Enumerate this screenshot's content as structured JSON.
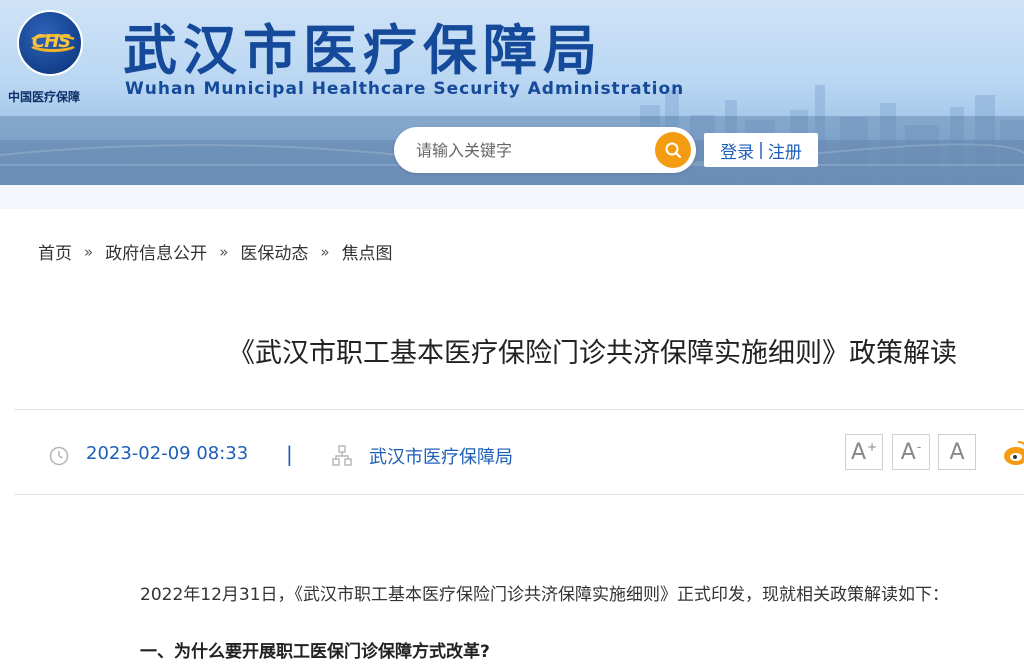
{
  "header": {
    "logo_text": "CHS",
    "logo_caption": "中国医疗保障",
    "site_title": "武汉市医疗保障局",
    "site_subtitle": "Wuhan Municipal Healthcare Security Administration",
    "search_placeholder": "请输入关键字",
    "login_label": "登录",
    "login_separator": "|",
    "register_label": "注册"
  },
  "breadcrumb": {
    "items": [
      "首页",
      "政府信息公开",
      "医保动态",
      "焦点图"
    ],
    "separator": "»"
  },
  "article": {
    "title": "《武汉市职工基本医疗保险门诊共济保障实施细则》政策解读",
    "date": "2023-02-09 08:33",
    "meta_separator": "|",
    "source": "武汉市医疗保障局",
    "font_controls": {
      "increase": "A",
      "decrease": "A",
      "reset": "A",
      "increase_mark": "+",
      "decrease_mark": "-"
    },
    "intro": "2022年12月31日，《武汉市职工基本医疗保险门诊共济保障实施细则》正式印发，现就相关政策解读如下：",
    "section_heading": "一、为什么要开展职工医保门诊保障方式改革?"
  },
  "colors": {
    "brand_blue": "#154a9a",
    "link_blue": "#1d5fb8",
    "search_orange": "#f39c12"
  }
}
